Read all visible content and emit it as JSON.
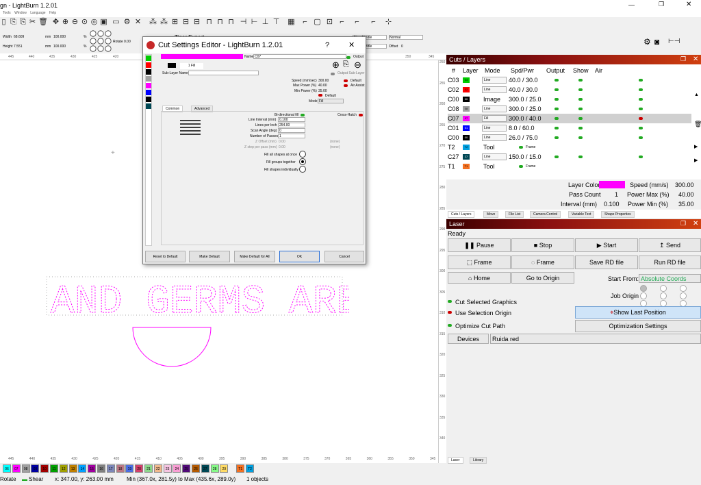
{
  "window": {
    "title": "gn - LightBurn 1.2.01",
    "minimize": "—",
    "maximize": "❐",
    "close": "✕"
  },
  "menu": [
    "Tools",
    "Window",
    "Language",
    "Help"
  ],
  "props": {
    "width_label": "Width",
    "width_value": "68.609",
    "height_label": "Height",
    "height_value": "7.551",
    "unit": "mm",
    "pct_value": "100.000",
    "pct_unit": "%",
    "rotate_label": "Rotate",
    "rotate_value": "0.00",
    "font_name": "Tiger Expert",
    "align_x": "Align Middle",
    "align_y": "Align Middle",
    "normal": "Normal",
    "offset_label": "Offset",
    "offset_value": "0"
  },
  "ruler_top": [
    "445",
    "440",
    "435",
    "430",
    "425",
    "420",
    "415",
    "410",
    "405",
    "400",
    "395",
    "390",
    "385",
    "380",
    "375",
    "370",
    "365",
    "360",
    "355",
    "350",
    "345"
  ],
  "ruler_top_bottom": [
    "445",
    "440",
    "435",
    "430",
    "425",
    "420",
    "415",
    "410",
    "405",
    "400",
    "395",
    "390",
    "385",
    "380",
    "375",
    "370",
    "365",
    "360",
    "355",
    "350",
    "345"
  ],
  "ruler_right": [
    "250",
    "255",
    "260",
    "265",
    "270",
    "275",
    "280",
    "285",
    "290",
    "295",
    "300",
    "305",
    "310",
    "315",
    "320",
    "325",
    "330",
    "335",
    "340"
  ],
  "canvas": {
    "text": "AND GERMS ARE",
    "text_color": "#ff00ff"
  },
  "palette": [
    {
      "label": "06",
      "color": "#00ffff"
    },
    {
      "label": "07",
      "color": "#ff00ff"
    },
    {
      "label": "08",
      "color": "#a0a0a0"
    },
    {
      "label": "09",
      "color": "#0000a0"
    },
    {
      "label": "10",
      "color": "#a00000"
    },
    {
      "label": "11",
      "color": "#00a000"
    },
    {
      "label": "12",
      "color": "#a0a000"
    },
    {
      "label": "13",
      "color": "#c08000"
    },
    {
      "label": "14",
      "color": "#00a0ff"
    },
    {
      "label": "15",
      "color": "#a000a0"
    },
    {
      "label": "16",
      "color": "#808080"
    },
    {
      "label": "17",
      "color": "#7d87b9"
    },
    {
      "label": "18",
      "color": "#bb7784"
    },
    {
      "label": "19",
      "color": "#4a6fe3"
    },
    {
      "label": "20",
      "color": "#d33f6a"
    },
    {
      "label": "21",
      "color": "#8cd78b"
    },
    {
      "label": "22",
      "color": "#f0b98d"
    },
    {
      "label": "23",
      "color": "#f6c4e1"
    },
    {
      "label": "24",
      "color": "#fa9ed4"
    },
    {
      "label": "25",
      "color": "#500a78"
    },
    {
      "label": "26",
      "color": "#b45a00"
    },
    {
      "label": "27",
      "color": "#004754"
    },
    {
      "label": "28",
      "color": "#86fa88"
    },
    {
      "label": "29",
      "color": "#ffdb66"
    },
    {
      "label": "T1",
      "color": "#f37021"
    },
    {
      "label": "T2",
      "color": "#00a0e0"
    }
  ],
  "status": {
    "rotate": "Rotate",
    "shear": "Shear",
    "coords": "x: 347.00, y: 263.00 mm",
    "range": "Min (367.0x, 281.5y) to Max (435.6x, 289.0y)",
    "objects": "1 objects"
  },
  "cuts": {
    "title": "Cuts / Layers",
    "headers": [
      "#",
      "Layer",
      "Mode",
      "Spd/Pwr",
      "Output",
      "Show",
      "Air"
    ],
    "rows": [
      {
        "num": "C03",
        "chip": "03",
        "color": "#00cc00",
        "mode": "Line",
        "spd": "40.0 / 30.0",
        "sel": false
      },
      {
        "num": "C02",
        "chip": "02",
        "color": "#ff0000",
        "mode": "Line",
        "spd": "40.0 / 30.0",
        "sel": false
      },
      {
        "num": "C00",
        "chip": "00",
        "color": "#000000",
        "mode": "Image",
        "spd": "300.0 / 25.0",
        "sel": false
      },
      {
        "num": "C08",
        "chip": "08",
        "color": "#a0a0a0",
        "mode": "Line",
        "spd": "300.0 / 25.0",
        "sel": false
      },
      {
        "num": "C07",
        "chip": "07",
        "color": "#ff00ff",
        "mode": "Fill",
        "spd": "300.0 / 40.0",
        "sel": true
      },
      {
        "num": "C01",
        "chip": "01",
        "color": "#0000ff",
        "mode": "Line",
        "spd": "8.0 / 60.0",
        "sel": false
      },
      {
        "num": "C00",
        "chip": "00",
        "color": "#000000",
        "mode": "Line",
        "spd": "26.0 / 75.0",
        "sel": false
      },
      {
        "num": "T2",
        "chip": "T2",
        "color": "#00a0e0",
        "mode": "Tool",
        "spd": "Frame",
        "sel": false
      },
      {
        "num": "C27",
        "chip": "27",
        "color": "#004754",
        "mode": "Line",
        "spd": "150.0 / 15.0",
        "sel": false
      },
      {
        "num": "T1",
        "chip": "T1",
        "color": "#f37021",
        "mode": "Tool",
        "spd": "Frame",
        "sel": false
      }
    ],
    "layer_color_label": "Layer Color",
    "speed_label": "Speed (mm/s)",
    "speed_value": "300.00",
    "pass_label": "Pass Count",
    "pass_value": "1",
    "powmax_label": "Power Max (%)",
    "powmax_value": "40.00",
    "interval_label": "Interval (mm)",
    "interval_value": "0.100",
    "powmin_label": "Power Min (%)",
    "powmin_value": "35.00",
    "tabs": [
      "Cuts / Layers",
      "Move",
      "File List",
      "Camera Control",
      "Variable Text",
      "Shape Properties"
    ]
  },
  "laser": {
    "title": "Laser",
    "status": "Ready",
    "pause": "Pause",
    "stop": "Stop",
    "start": "Start",
    "send": "Send",
    "frame1": "Frame",
    "frame2": "Frame",
    "save_rd": "Save RD file",
    "run_rd": "Run RD file",
    "home": "Home",
    "goto_origin": "Go to Origin",
    "start_from_label": "Start From:",
    "start_from_value": "Absolute Coords",
    "job_origin": "Job Origin",
    "cut_selected": "Cut Selected Graphics",
    "use_selection": "Use Selection Origin",
    "optimize": "Optimize Cut Path",
    "show_last": "Show Last Position",
    "opt_settings": "Optimization Settings",
    "devices": "Devices",
    "device_value": "Ruida red",
    "tabs": [
      "Laser",
      "Library"
    ]
  },
  "dialog": {
    "title": "Cut Settings Editor - LightBurn 1.2.01",
    "help": "?",
    "close": "✕",
    "name_label": "Name",
    "name_value": "C07",
    "output_label": "Output",
    "fill_label": "1 Fill",
    "sublayer_label": "Sub-Layer Name",
    "output_sublayer": "Output Sub-Layer",
    "speed_label": "Speed (mm/sec)",
    "speed_value": "300.00",
    "maxpow_label": "Max Power (%)",
    "maxpow_value": "40.00",
    "minpow_label": "Min Power (%)",
    "minpow_value": "35.00",
    "default_label": "Default",
    "air_label": "Air Assist",
    "default2": "Default",
    "mode_label": "Mode",
    "mode_value": "Fill",
    "tab_common": "Common",
    "tab_advanced": "Advanced",
    "bidir": "Bi-directional fill",
    "crosshatch": "Cross-Hatch",
    "line_interval_label": "Line Interval (mm)",
    "line_interval_value": "0.100",
    "lpi_label": "Lines per Inch",
    "lpi_value": "254.00",
    "scan_label": "Scan Angle (deg)",
    "scan_value": "0",
    "passes_label": "Number of Passes",
    "passes_value": "1",
    "zoffset_label": "Z Offset (mm)",
    "zoffset_value": "0.00",
    "none1": "(none)",
    "zstep_label": "Z step per pass (mm)",
    "zstep_value": "0.00",
    "none2": "(none)",
    "fill_all": "Fill all shapes at once",
    "fill_groups": "Fill groups together",
    "fill_individually": "Fill shapes individually",
    "reset": "Reset to Default",
    "make_default": "Make Default",
    "make_default_all": "Make Default for All",
    "ok": "OK",
    "cancel": "Cancel"
  }
}
